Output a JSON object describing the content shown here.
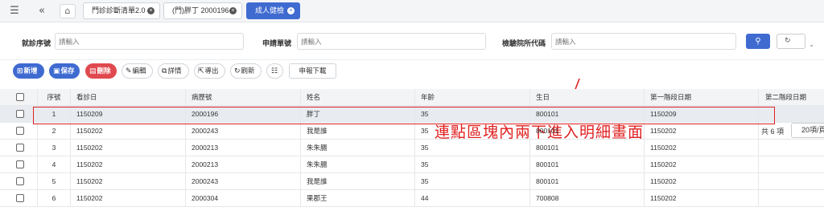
{
  "topbar": {
    "menu_icon": "hamburger-icon",
    "collapse_icon": "double-chevron-left-icon",
    "home_icon": "home-icon",
    "tabs": [
      {
        "label": "門診診斷清單2.0",
        "active": false
      },
      {
        "label": "(門)胖丁 2000196",
        "active": false
      },
      {
        "label": "成人健檢",
        "active": true
      }
    ]
  },
  "search": {
    "fields": [
      {
        "label": "就診序號",
        "placeholder": "請輸入"
      },
      {
        "label": "申請單號",
        "placeholder": "請輸入"
      },
      {
        "label": "檢驗院所代碼",
        "placeholder": "請輸入"
      }
    ],
    "search_icon": "search-icon",
    "reset_icon": "refresh-icon"
  },
  "toolbar": {
    "buttons": [
      {
        "label": "新增",
        "icon": "add-icon",
        "style": "primary"
      },
      {
        "label": "保存",
        "icon": "save-icon",
        "style": "primary"
      },
      {
        "label": "刪除",
        "icon": "trash-icon",
        "style": "danger"
      },
      {
        "label": "編輯",
        "icon": "pencil-icon",
        "style": "default"
      },
      {
        "label": "詳情",
        "icon": "detail-icon",
        "style": "default"
      },
      {
        "label": "導出",
        "icon": "export-icon",
        "style": "default"
      },
      {
        "label": "刷新",
        "icon": "refresh-icon",
        "style": "default"
      },
      {
        "label": "",
        "icon": "column-settings-icon",
        "style": "default"
      },
      {
        "label": "申報下載",
        "icon": "",
        "style": "plain"
      }
    ],
    "annotation": "連點區塊內兩下進入明細畫面",
    "count_text": "共 6 項",
    "page_size": "20項/頁"
  },
  "table": {
    "headers": [
      "序號",
      "看診日",
      "病歷號",
      "姓名",
      "年齡",
      "生日",
      "第一階段日期",
      "第二階段日期"
    ],
    "rows": [
      [
        "1",
        "1150209",
        "2000196",
        "胖丁",
        "35",
        "800101",
        "1150209",
        ""
      ],
      [
        "2",
        "1150202",
        "2000243",
        "我是誰",
        "35",
        "800101",
        "1150202",
        ""
      ],
      [
        "3",
        "1150202",
        "2000213",
        "朱朱腸",
        "35",
        "800101",
        "1150202",
        ""
      ],
      [
        "4",
        "1150202",
        "2000213",
        "朱朱腸",
        "35",
        "800101",
        "1150202",
        ""
      ],
      [
        "5",
        "1150202",
        "2000243",
        "我是誰",
        "35",
        "800101",
        "1150202",
        ""
      ],
      [
        "6",
        "1150202",
        "2000304",
        "果郡王",
        "44",
        "700808",
        "1150202",
        ""
      ]
    ],
    "selected_row": 0
  },
  "colors": {
    "primary": "#3f6bd1",
    "danger": "#e0494f",
    "annotation": "#e02020"
  }
}
